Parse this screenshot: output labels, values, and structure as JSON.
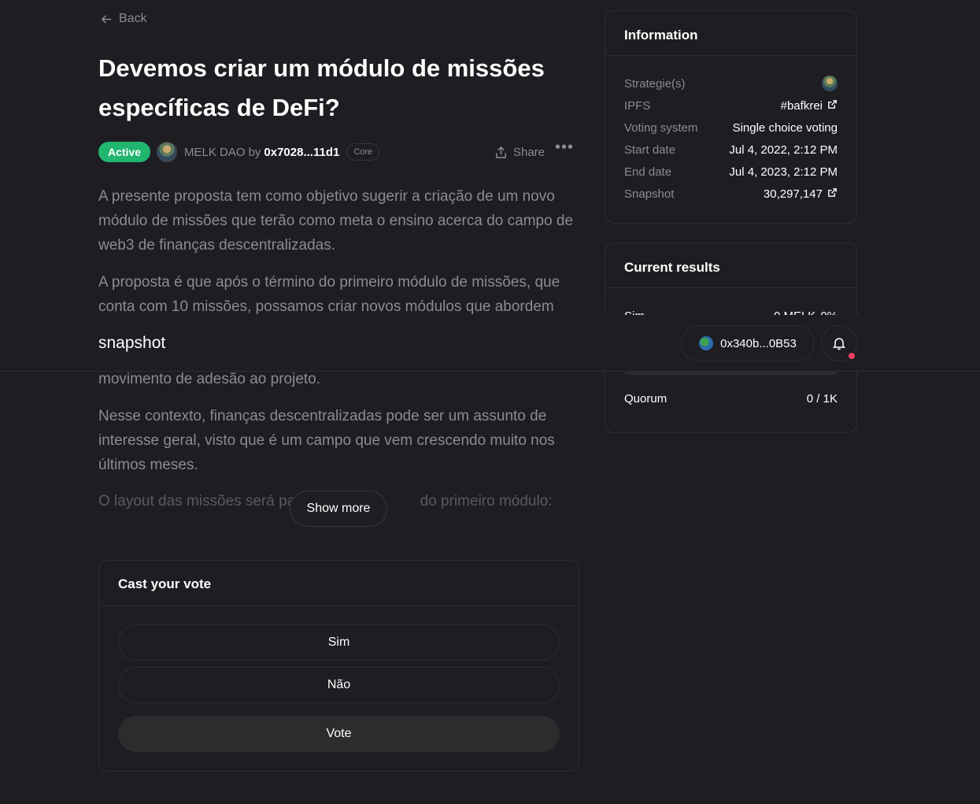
{
  "nav": {
    "back_label": "Back"
  },
  "proposal": {
    "title": "Devemos criar um módulo de missões específicas de DeFi?",
    "state": "Active",
    "space_name": "MELK DAO",
    "by_label": "by",
    "author": "0x7028...11d1",
    "author_badge": "Core",
    "share_label": "Share",
    "more_label": "•••",
    "paragraphs": [
      "A presente proposta tem como objetivo sugerir a criação de um novo módulo de missões que terão como meta o ensino acerca do campo de web3 de finanças descentralizadas.",
      "A proposta é que após o término do primeiro módulo de missões, que conta com 10 missões, possamos criar novos módulos que abordem",
      "movimento de adesão ao projeto.",
      "Nesse contexto, finanças descentralizadas pode ser um assunto de interesse geral, visto que é um campo que vem crescendo muito nos últimos meses.",
      "O layout das missões será pa                              do primeiro módulo:"
    ],
    "show_more_label": "Show more"
  },
  "vote": {
    "title": "Cast your vote",
    "choices": [
      "Sim",
      "Não"
    ],
    "submit_label": "Vote"
  },
  "information": {
    "title": "Information",
    "rows": [
      {
        "key": "Strategie(s)",
        "value": ""
      },
      {
        "key": "IPFS",
        "value": "#bafkrei"
      },
      {
        "key": "Voting system",
        "value": "Single choice voting"
      },
      {
        "key": "Start date",
        "value": "Jul 4, 2022, 2:12 PM"
      },
      {
        "key": "End date",
        "value": "Jul 4, 2023, 2:12 PM"
      },
      {
        "key": "Snapshot",
        "value": "30,297,147"
      }
    ]
  },
  "results": {
    "title": "Current results",
    "first_choice": "Sim",
    "first_value": "0 MELK",
    "first_percent": "0%",
    "first_fraction": 0,
    "quorum_label": "Quorum",
    "quorum_value": "0 / 1K"
  },
  "topbar": {
    "brand": "snapshot",
    "account": "0x340b...0B53"
  },
  "colors": {
    "background": "#1e1d22",
    "border": "#2e2d33",
    "active_green": "#21b66f",
    "notification_red": "#f43f5e",
    "text_muted": "#8b8b94",
    "text_primary": "#ffffff"
  },
  "icons": [
    "arrow-left-icon",
    "share-icon",
    "external-link-icon",
    "bell-icon",
    "globe-icon"
  ]
}
